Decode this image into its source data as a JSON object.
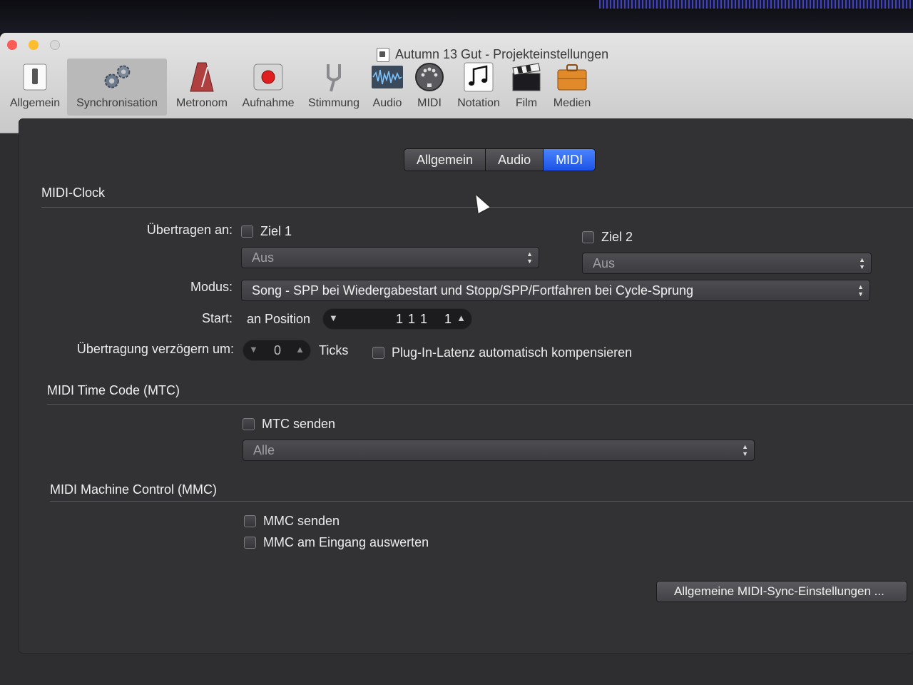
{
  "window": {
    "title": "Autumn 13 Gut - Projekteinstellungen"
  },
  "toolbar": {
    "items": [
      {
        "label": "Allgemein",
        "icon": "switch-icon"
      },
      {
        "label": "Synchronisation",
        "icon": "gears-icon",
        "active": true
      },
      {
        "label": "Metronom",
        "icon": "metronome-icon"
      },
      {
        "label": "Aufnahme",
        "icon": "record-icon"
      },
      {
        "label": "Stimmung",
        "icon": "tuning-fork-icon"
      },
      {
        "label": "Audio",
        "icon": "waveform-icon"
      },
      {
        "label": "MIDI",
        "icon": "midi-port-icon"
      },
      {
        "label": "Notation",
        "icon": "music-notes-icon"
      },
      {
        "label": "Film",
        "icon": "clapperboard-icon"
      },
      {
        "label": "Medien",
        "icon": "briefcase-icon"
      }
    ]
  },
  "tabs": [
    {
      "label": "Allgemein",
      "selected": false
    },
    {
      "label": "Audio",
      "selected": false
    },
    {
      "label": "MIDI",
      "selected": true
    }
  ],
  "midi_clock": {
    "title": "MIDI-Clock",
    "transmit_label": "Übertragen an:",
    "dest1": {
      "label": "Ziel 1",
      "checked": false,
      "value": "Aus"
    },
    "dest2": {
      "label": "Ziel 2",
      "checked": false,
      "value": "Aus"
    },
    "mode_label": "Modus:",
    "mode_value": "Song - SPP bei Wiedergabestart und Stopp/SPP/Fortfahren bei Cycle-Sprung",
    "start_label": "Start:",
    "start_prefix": "an Position",
    "start_value_a": "1 1 1",
    "start_value_b": "1",
    "delay_label": "Übertragung verzögern um:",
    "delay_value": "0",
    "delay_unit": "Ticks",
    "plugin_latency": {
      "label": "Plug-In-Latenz automatisch kompensieren",
      "checked": false
    }
  },
  "mtc": {
    "title": "MIDI Time Code (MTC)",
    "send": {
      "label": "MTC senden",
      "checked": false
    },
    "target": "Alle"
  },
  "mmc": {
    "title": "MIDI Machine Control (MMC)",
    "send": {
      "label": "MMC senden",
      "checked": false
    },
    "eval": {
      "label": "MMC am Eingang auswerten",
      "checked": false
    }
  },
  "footer": {
    "button_label": "Allgemeine MIDI-Sync-Einstellungen ..."
  }
}
